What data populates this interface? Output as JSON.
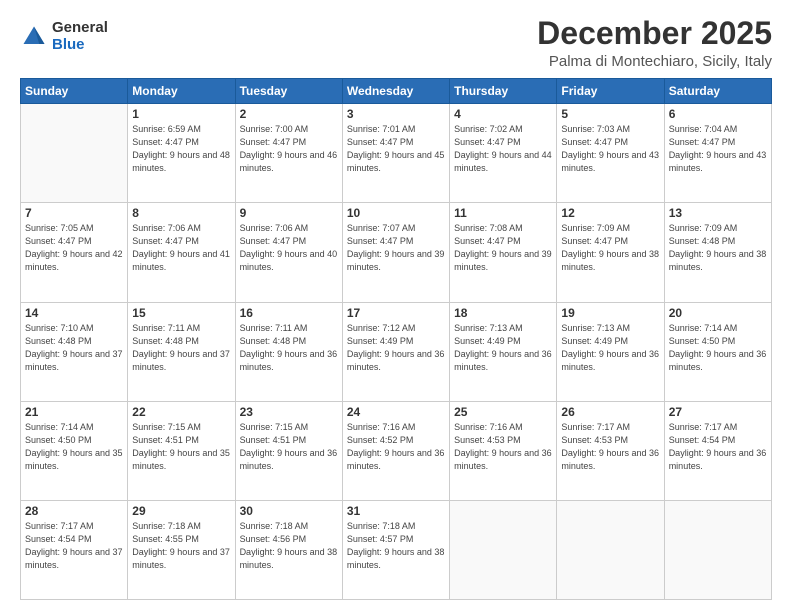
{
  "header": {
    "logo_general": "General",
    "logo_blue": "Blue",
    "month_title": "December 2025",
    "location": "Palma di Montechiaro, Sicily, Italy"
  },
  "days_of_week": [
    "Sunday",
    "Monday",
    "Tuesday",
    "Wednesday",
    "Thursday",
    "Friday",
    "Saturday"
  ],
  "weeks": [
    [
      {
        "day": "",
        "sunrise": "",
        "sunset": "",
        "daylight": ""
      },
      {
        "day": "1",
        "sunrise": "Sunrise: 6:59 AM",
        "sunset": "Sunset: 4:47 PM",
        "daylight": "Daylight: 9 hours and 48 minutes."
      },
      {
        "day": "2",
        "sunrise": "Sunrise: 7:00 AM",
        "sunset": "Sunset: 4:47 PM",
        "daylight": "Daylight: 9 hours and 46 minutes."
      },
      {
        "day": "3",
        "sunrise": "Sunrise: 7:01 AM",
        "sunset": "Sunset: 4:47 PM",
        "daylight": "Daylight: 9 hours and 45 minutes."
      },
      {
        "day": "4",
        "sunrise": "Sunrise: 7:02 AM",
        "sunset": "Sunset: 4:47 PM",
        "daylight": "Daylight: 9 hours and 44 minutes."
      },
      {
        "day": "5",
        "sunrise": "Sunrise: 7:03 AM",
        "sunset": "Sunset: 4:47 PM",
        "daylight": "Daylight: 9 hours and 43 minutes."
      },
      {
        "day": "6",
        "sunrise": "Sunrise: 7:04 AM",
        "sunset": "Sunset: 4:47 PM",
        "daylight": "Daylight: 9 hours and 43 minutes."
      }
    ],
    [
      {
        "day": "7",
        "sunrise": "Sunrise: 7:05 AM",
        "sunset": "Sunset: 4:47 PM",
        "daylight": "Daylight: 9 hours and 42 minutes."
      },
      {
        "day": "8",
        "sunrise": "Sunrise: 7:06 AM",
        "sunset": "Sunset: 4:47 PM",
        "daylight": "Daylight: 9 hours and 41 minutes."
      },
      {
        "day": "9",
        "sunrise": "Sunrise: 7:06 AM",
        "sunset": "Sunset: 4:47 PM",
        "daylight": "Daylight: 9 hours and 40 minutes."
      },
      {
        "day": "10",
        "sunrise": "Sunrise: 7:07 AM",
        "sunset": "Sunset: 4:47 PM",
        "daylight": "Daylight: 9 hours and 39 minutes."
      },
      {
        "day": "11",
        "sunrise": "Sunrise: 7:08 AM",
        "sunset": "Sunset: 4:47 PM",
        "daylight": "Daylight: 9 hours and 39 minutes."
      },
      {
        "day": "12",
        "sunrise": "Sunrise: 7:09 AM",
        "sunset": "Sunset: 4:47 PM",
        "daylight": "Daylight: 9 hours and 38 minutes."
      },
      {
        "day": "13",
        "sunrise": "Sunrise: 7:09 AM",
        "sunset": "Sunset: 4:48 PM",
        "daylight": "Daylight: 9 hours and 38 minutes."
      }
    ],
    [
      {
        "day": "14",
        "sunrise": "Sunrise: 7:10 AM",
        "sunset": "Sunset: 4:48 PM",
        "daylight": "Daylight: 9 hours and 37 minutes."
      },
      {
        "day": "15",
        "sunrise": "Sunrise: 7:11 AM",
        "sunset": "Sunset: 4:48 PM",
        "daylight": "Daylight: 9 hours and 37 minutes."
      },
      {
        "day": "16",
        "sunrise": "Sunrise: 7:11 AM",
        "sunset": "Sunset: 4:48 PM",
        "daylight": "Daylight: 9 hours and 36 minutes."
      },
      {
        "day": "17",
        "sunrise": "Sunrise: 7:12 AM",
        "sunset": "Sunset: 4:49 PM",
        "daylight": "Daylight: 9 hours and 36 minutes."
      },
      {
        "day": "18",
        "sunrise": "Sunrise: 7:13 AM",
        "sunset": "Sunset: 4:49 PM",
        "daylight": "Daylight: 9 hours and 36 minutes."
      },
      {
        "day": "19",
        "sunrise": "Sunrise: 7:13 AM",
        "sunset": "Sunset: 4:49 PM",
        "daylight": "Daylight: 9 hours and 36 minutes."
      },
      {
        "day": "20",
        "sunrise": "Sunrise: 7:14 AM",
        "sunset": "Sunset: 4:50 PM",
        "daylight": "Daylight: 9 hours and 36 minutes."
      }
    ],
    [
      {
        "day": "21",
        "sunrise": "Sunrise: 7:14 AM",
        "sunset": "Sunset: 4:50 PM",
        "daylight": "Daylight: 9 hours and 35 minutes."
      },
      {
        "day": "22",
        "sunrise": "Sunrise: 7:15 AM",
        "sunset": "Sunset: 4:51 PM",
        "daylight": "Daylight: 9 hours and 35 minutes."
      },
      {
        "day": "23",
        "sunrise": "Sunrise: 7:15 AM",
        "sunset": "Sunset: 4:51 PM",
        "daylight": "Daylight: 9 hours and 36 minutes."
      },
      {
        "day": "24",
        "sunrise": "Sunrise: 7:16 AM",
        "sunset": "Sunset: 4:52 PM",
        "daylight": "Daylight: 9 hours and 36 minutes."
      },
      {
        "day": "25",
        "sunrise": "Sunrise: 7:16 AM",
        "sunset": "Sunset: 4:53 PM",
        "daylight": "Daylight: 9 hours and 36 minutes."
      },
      {
        "day": "26",
        "sunrise": "Sunrise: 7:17 AM",
        "sunset": "Sunset: 4:53 PM",
        "daylight": "Daylight: 9 hours and 36 minutes."
      },
      {
        "day": "27",
        "sunrise": "Sunrise: 7:17 AM",
        "sunset": "Sunset: 4:54 PM",
        "daylight": "Daylight: 9 hours and 36 minutes."
      }
    ],
    [
      {
        "day": "28",
        "sunrise": "Sunrise: 7:17 AM",
        "sunset": "Sunset: 4:54 PM",
        "daylight": "Daylight: 9 hours and 37 minutes."
      },
      {
        "day": "29",
        "sunrise": "Sunrise: 7:18 AM",
        "sunset": "Sunset: 4:55 PM",
        "daylight": "Daylight: 9 hours and 37 minutes."
      },
      {
        "day": "30",
        "sunrise": "Sunrise: 7:18 AM",
        "sunset": "Sunset: 4:56 PM",
        "daylight": "Daylight: 9 hours and 38 minutes."
      },
      {
        "day": "31",
        "sunrise": "Sunrise: 7:18 AM",
        "sunset": "Sunset: 4:57 PM",
        "daylight": "Daylight: 9 hours and 38 minutes."
      },
      {
        "day": "",
        "sunrise": "",
        "sunset": "",
        "daylight": ""
      },
      {
        "day": "",
        "sunrise": "",
        "sunset": "",
        "daylight": ""
      },
      {
        "day": "",
        "sunrise": "",
        "sunset": "",
        "daylight": ""
      }
    ]
  ]
}
